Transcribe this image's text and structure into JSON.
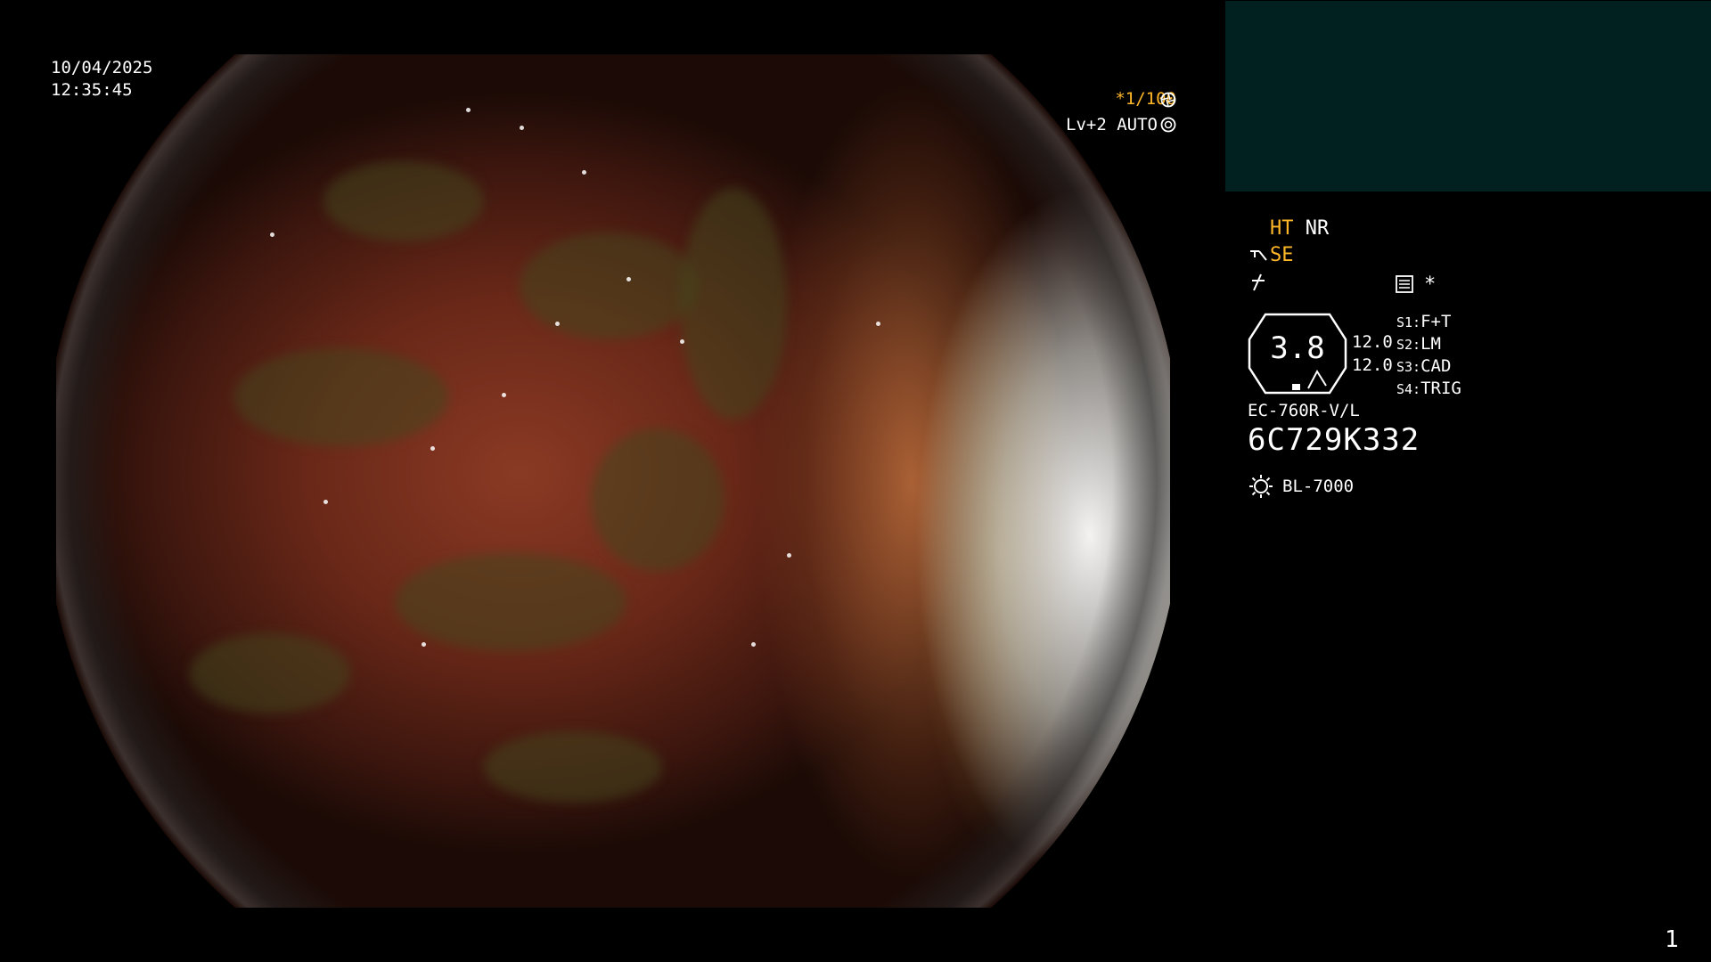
{
  "datetime": {
    "date": "10/04/2025",
    "time": "12:35:45"
  },
  "overlay": {
    "shutter": "*1/100",
    "shutter_icon": "aperture-icon",
    "iris": "Lv+2 AUTO",
    "iris_icon": "iris-icon"
  },
  "panel": {
    "ht": "HT",
    "nr": "NR",
    "se": "SE",
    "se_icon": "enhance-icon",
    "freeze_icon": "freeze-icon",
    "memory_icon": "memory-icon",
    "memory_star": "*",
    "gauge_value": "3.8",
    "gauge_top": "12.0",
    "gauge_bottom": "12.0",
    "switches": [
      {
        "key": "S1:",
        "value": "F+T"
      },
      {
        "key": "S2:",
        "value": "LM"
      },
      {
        "key": "S3:",
        "value": "CAD"
      },
      {
        "key": "S4:",
        "value": "TRIG"
      }
    ],
    "scope_model": "EC-760R-V/L",
    "serial": "6C729K332",
    "light_icon": "light-source-icon",
    "light_source": "BL-7000"
  },
  "page_number": "1",
  "colors": {
    "accent_yellow": "#ffb728",
    "panel_teal": "#00211f",
    "background": "#000000"
  }
}
